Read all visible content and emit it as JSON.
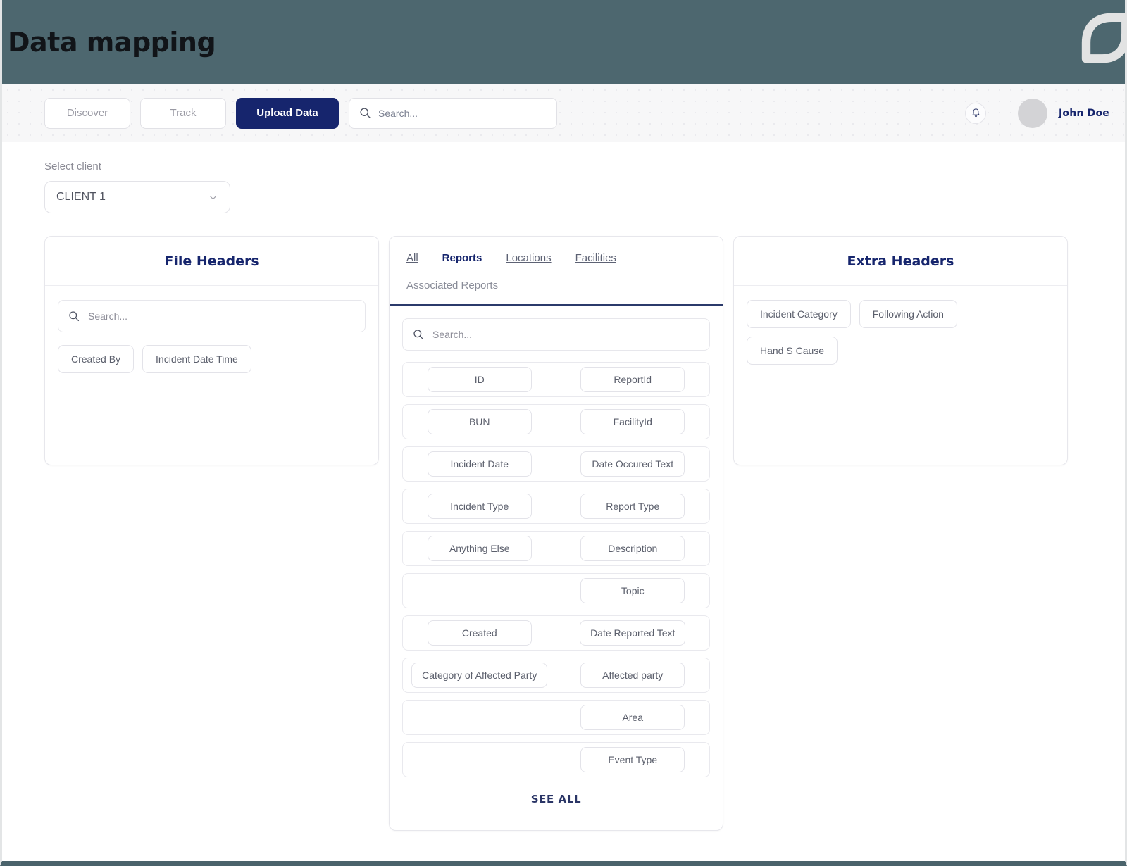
{
  "banner": {
    "title": "Data mapping",
    "logo_icon": "leaf-logo-icon",
    "background_color": "#4d676f"
  },
  "toolbar": {
    "discover_label": "Discover",
    "track_label": "Track",
    "upload_label": "Upload Data",
    "upload_color": "#16256d",
    "search": {
      "placeholder": "Search...",
      "value": "",
      "icon": "search-icon"
    },
    "bell_icon": "notification-bell-icon",
    "user_name": "John Doe",
    "avatar_icon": "user-avatar"
  },
  "client": {
    "label": "Select client",
    "selected": "CLIENT 1",
    "chevron_icon": "chevron-down-icon"
  },
  "file_headers": {
    "title": "File Headers",
    "search": {
      "placeholder": "Search...",
      "value": "",
      "icon": "search-icon"
    },
    "chips": [
      "Created By",
      "Incident Date Time"
    ]
  },
  "extra_headers": {
    "title": "Extra Headers",
    "chips": [
      "Incident Category",
      "Following Action",
      "Hand S Cause"
    ]
  },
  "mapping": {
    "tabs": [
      {
        "label": "All",
        "active": false
      },
      {
        "label": "Reports",
        "active": true
      },
      {
        "label": "Locations",
        "active": false
      },
      {
        "label": "Facilities",
        "active": false
      }
    ],
    "subtitle": "Associated Reports",
    "search": {
      "placeholder": "Search...",
      "value": "",
      "icon": "search-icon"
    },
    "rows": [
      {
        "left": "ID",
        "right": "ReportId"
      },
      {
        "left": "BUN",
        "right": "FacilityId"
      },
      {
        "left": "Incident Date",
        "right": "Date Occured Text"
      },
      {
        "left": "Incident Type",
        "right": "Report Type"
      },
      {
        "left": "Anything Else",
        "right": "Description"
      },
      {
        "left": "",
        "right": "Topic"
      },
      {
        "left": "Created",
        "right": "Date Reported Text"
      },
      {
        "left": "Category of Affected Party",
        "right": "Affected party"
      },
      {
        "left": "",
        "right": "Area"
      },
      {
        "left": "",
        "right": "Event Type"
      }
    ],
    "see_all_label": "SEE ALL"
  }
}
